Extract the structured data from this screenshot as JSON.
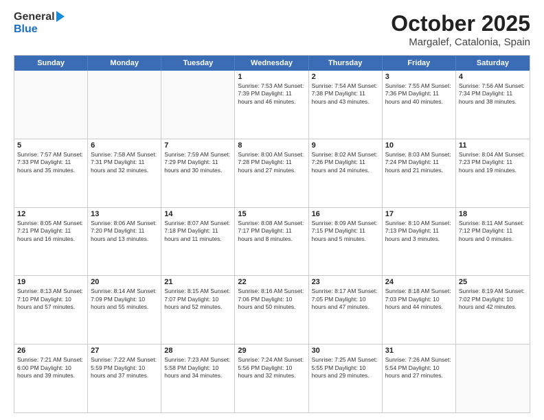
{
  "header": {
    "logo_general": "General",
    "logo_blue": "Blue",
    "month_title": "October 2025",
    "location": "Margalef, Catalonia, Spain"
  },
  "days_of_week": [
    "Sunday",
    "Monday",
    "Tuesday",
    "Wednesday",
    "Thursday",
    "Friday",
    "Saturday"
  ],
  "weeks": [
    [
      {
        "day": "",
        "info": ""
      },
      {
        "day": "",
        "info": ""
      },
      {
        "day": "",
        "info": ""
      },
      {
        "day": "1",
        "info": "Sunrise: 7:53 AM\nSunset: 7:39 PM\nDaylight: 11 hours and 46 minutes."
      },
      {
        "day": "2",
        "info": "Sunrise: 7:54 AM\nSunset: 7:38 PM\nDaylight: 11 hours and 43 minutes."
      },
      {
        "day": "3",
        "info": "Sunrise: 7:55 AM\nSunset: 7:36 PM\nDaylight: 11 hours and 40 minutes."
      },
      {
        "day": "4",
        "info": "Sunrise: 7:56 AM\nSunset: 7:34 PM\nDaylight: 11 hours and 38 minutes."
      }
    ],
    [
      {
        "day": "5",
        "info": "Sunrise: 7:57 AM\nSunset: 7:33 PM\nDaylight: 11 hours and 35 minutes."
      },
      {
        "day": "6",
        "info": "Sunrise: 7:58 AM\nSunset: 7:31 PM\nDaylight: 11 hours and 32 minutes."
      },
      {
        "day": "7",
        "info": "Sunrise: 7:59 AM\nSunset: 7:29 PM\nDaylight: 11 hours and 30 minutes."
      },
      {
        "day": "8",
        "info": "Sunrise: 8:00 AM\nSunset: 7:28 PM\nDaylight: 11 hours and 27 minutes."
      },
      {
        "day": "9",
        "info": "Sunrise: 8:02 AM\nSunset: 7:26 PM\nDaylight: 11 hours and 24 minutes."
      },
      {
        "day": "10",
        "info": "Sunrise: 8:03 AM\nSunset: 7:24 PM\nDaylight: 11 hours and 21 minutes."
      },
      {
        "day": "11",
        "info": "Sunrise: 8:04 AM\nSunset: 7:23 PM\nDaylight: 11 hours and 19 minutes."
      }
    ],
    [
      {
        "day": "12",
        "info": "Sunrise: 8:05 AM\nSunset: 7:21 PM\nDaylight: 11 hours and 16 minutes."
      },
      {
        "day": "13",
        "info": "Sunrise: 8:06 AM\nSunset: 7:20 PM\nDaylight: 11 hours and 13 minutes."
      },
      {
        "day": "14",
        "info": "Sunrise: 8:07 AM\nSunset: 7:18 PM\nDaylight: 11 hours and 11 minutes."
      },
      {
        "day": "15",
        "info": "Sunrise: 8:08 AM\nSunset: 7:17 PM\nDaylight: 11 hours and 8 minutes."
      },
      {
        "day": "16",
        "info": "Sunrise: 8:09 AM\nSunset: 7:15 PM\nDaylight: 11 hours and 5 minutes."
      },
      {
        "day": "17",
        "info": "Sunrise: 8:10 AM\nSunset: 7:13 PM\nDaylight: 11 hours and 3 minutes."
      },
      {
        "day": "18",
        "info": "Sunrise: 8:11 AM\nSunset: 7:12 PM\nDaylight: 11 hours and 0 minutes."
      }
    ],
    [
      {
        "day": "19",
        "info": "Sunrise: 8:13 AM\nSunset: 7:10 PM\nDaylight: 10 hours and 57 minutes."
      },
      {
        "day": "20",
        "info": "Sunrise: 8:14 AM\nSunset: 7:09 PM\nDaylight: 10 hours and 55 minutes."
      },
      {
        "day": "21",
        "info": "Sunrise: 8:15 AM\nSunset: 7:07 PM\nDaylight: 10 hours and 52 minutes."
      },
      {
        "day": "22",
        "info": "Sunrise: 8:16 AM\nSunset: 7:06 PM\nDaylight: 10 hours and 50 minutes."
      },
      {
        "day": "23",
        "info": "Sunrise: 8:17 AM\nSunset: 7:05 PM\nDaylight: 10 hours and 47 minutes."
      },
      {
        "day": "24",
        "info": "Sunrise: 8:18 AM\nSunset: 7:03 PM\nDaylight: 10 hours and 44 minutes."
      },
      {
        "day": "25",
        "info": "Sunrise: 8:19 AM\nSunset: 7:02 PM\nDaylight: 10 hours and 42 minutes."
      }
    ],
    [
      {
        "day": "26",
        "info": "Sunrise: 7:21 AM\nSunset: 6:00 PM\nDaylight: 10 hours and 39 minutes."
      },
      {
        "day": "27",
        "info": "Sunrise: 7:22 AM\nSunset: 5:59 PM\nDaylight: 10 hours and 37 minutes."
      },
      {
        "day": "28",
        "info": "Sunrise: 7:23 AM\nSunset: 5:58 PM\nDaylight: 10 hours and 34 minutes."
      },
      {
        "day": "29",
        "info": "Sunrise: 7:24 AM\nSunset: 5:56 PM\nDaylight: 10 hours and 32 minutes."
      },
      {
        "day": "30",
        "info": "Sunrise: 7:25 AM\nSunset: 5:55 PM\nDaylight: 10 hours and 29 minutes."
      },
      {
        "day": "31",
        "info": "Sunrise: 7:26 AM\nSunset: 5:54 PM\nDaylight: 10 hours and 27 minutes."
      },
      {
        "day": "",
        "info": ""
      }
    ]
  ]
}
